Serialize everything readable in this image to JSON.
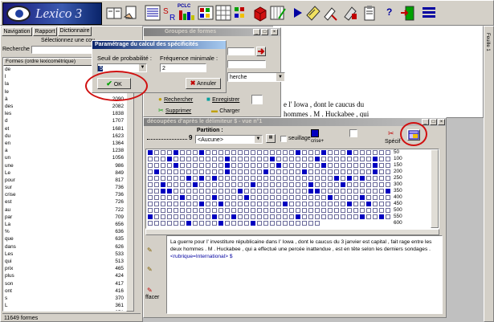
{
  "app": {
    "logo_text": "Lexico 3"
  },
  "toolbar": {
    "icons": [
      "open-book-icon",
      "hand-document-icon",
      "list-icon",
      "formula-icon",
      "pclc-chart-icon",
      "palette-icon",
      "grid-icon",
      "color-grid-icon",
      "red-cube-icon",
      "edit-grid-icon",
      "play-arrow-icon",
      "notes-icon",
      "tools-icon",
      "calculator-icon",
      "help-icon",
      "exit-door-icon",
      "stack-icon"
    ],
    "pclc_label": "PCLC",
    "sr_label": "SR",
    "help_label": "?"
  },
  "left_panel": {
    "tabs": [
      "Navigation",
      "Rapport",
      "Dictionnaire"
    ],
    "select_prompt": "Sélectionnez une cou",
    "search_label": "Recherche :",
    "col_forms": "Formes (ordre lexicométrique)",
    "rows": [
      {
        "form": "de",
        "count": ""
      },
      {
        "form": "l",
        "count": ""
      },
      {
        "form": "la",
        "count": ""
      },
      {
        "form": "le",
        "count": ""
      },
      {
        "form": "à",
        "count": "2090"
      },
      {
        "form": "des",
        "count": "2082"
      },
      {
        "form": "les",
        "count": "1838"
      },
      {
        "form": "d",
        "count": "1707"
      },
      {
        "form": "et",
        "count": "1681"
      },
      {
        "form": "du",
        "count": "1623"
      },
      {
        "form": "en",
        "count": "1364"
      },
      {
        "form": "a",
        "count": "1238"
      },
      {
        "form": "un",
        "count": "1056"
      },
      {
        "form": "une",
        "count": "986"
      },
      {
        "form": "Le",
        "count": "849"
      },
      {
        "form": "pour",
        "count": "817"
      },
      {
        "form": "sur",
        "count": "736"
      },
      {
        "form": "crise",
        "count": "736"
      },
      {
        "form": "est",
        "count": "726"
      },
      {
        "form": "au",
        "count": "722"
      },
      {
        "form": "par",
        "count": "709"
      },
      {
        "form": "La",
        "count": "656"
      },
      {
        "form": "%",
        "count": "636"
      },
      {
        "form": "que",
        "count": "635"
      },
      {
        "form": "dans",
        "count": "626"
      },
      {
        "form": "Les",
        "count": "533"
      },
      {
        "form": "qui",
        "count": "513"
      },
      {
        "form": "prix",
        "count": "465"
      },
      {
        "form": "plus",
        "count": "424"
      },
      {
        "form": "son",
        "count": "417"
      },
      {
        "form": "ont",
        "count": "416"
      },
      {
        "form": "s",
        "count": "370"
      },
      {
        "form": "L",
        "count": "361"
      },
      {
        "form": "aux",
        "count": "351"
      },
      {
        "form": "se",
        "count": "302"
      },
      {
        "form": "pas",
        "count": "295"
      }
    ],
    "status": "11649 formes"
  },
  "dialog": {
    "title": "Paramétrage du calcul des spécificités",
    "threshold_label": "Seuil de probabilité :",
    "threshold_value": "5",
    "freq_label": "Fréquence minimale :",
    "freq_value": "2",
    "ok_label": "OK",
    "cancel_label": "Annuler"
  },
  "groups_window": {
    "title": "Groupes de formes",
    "combo_value": "herche",
    "search_label": "Rechercher",
    "save_label": "Enregistrer",
    "delete_label": "Supprimer",
    "load_label": "Charger"
  },
  "text_window": {
    "line1": "e l' Iowa , dont le caucus du",
    "line2": "hommes . M . Huckabee , qui"
  },
  "segments_window": {
    "title": "découpées d'après le délimiteur  $ - vue n°1",
    "partition_label": "Partition :",
    "partition_value": "<Aucune>",
    "number": "9",
    "seuillage_label": "seuillage",
    "crise_label": "crise+",
    "spec_label": "Spécif",
    "scale": [
      "50",
      "100",
      "150",
      "200",
      "250",
      "300",
      "350",
      "400",
      "450",
      "500",
      "550",
      "600"
    ],
    "text": "La guerre pour l' investiture républicaine dans l' Iowa , dont le caucus du 3 janvier est capital , fait rage entre les deux hommes . M . Huckabee , qui a effectué une percée inattendue , est en tête selon les derniers sondages .",
    "rubrique": "<rubrique=International> $",
    "effacer_label": "ffacer"
  },
  "right_side": {
    "tab_label": "Feuille 1"
  },
  "colors": {
    "grid_on": "#0000c0",
    "highlight_ellipse": "#d01010"
  }
}
